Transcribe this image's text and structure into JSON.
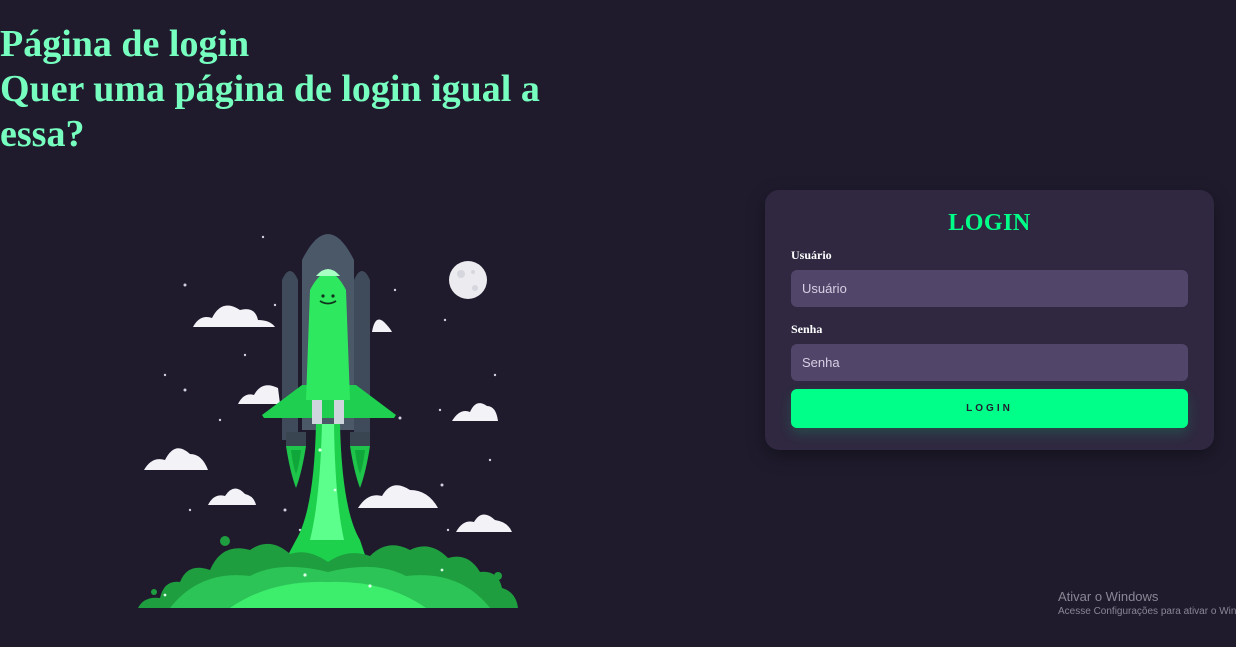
{
  "hero": {
    "line1": "Página de login",
    "line2": "Quer uma página de login igual a",
    "line3": "essa?"
  },
  "login": {
    "title": "LOGIN",
    "user_label": "Usuário",
    "user_placeholder": "Usuário",
    "user_value": "",
    "pass_label": "Senha",
    "pass_placeholder": "Senha",
    "pass_value": "",
    "button_label": "LOGIN"
  },
  "watermark": {
    "title": "Ativar o Windows",
    "subtitle": "Acesse Configurações para ativar o Windows."
  },
  "colors": {
    "background": "#1f1b2d",
    "accent": "#00ff88",
    "hero_text": "#77ffc0",
    "card": "#2f2840",
    "input": "#514569"
  },
  "icons": {
    "illustration": "rocket-launch-illustration"
  }
}
